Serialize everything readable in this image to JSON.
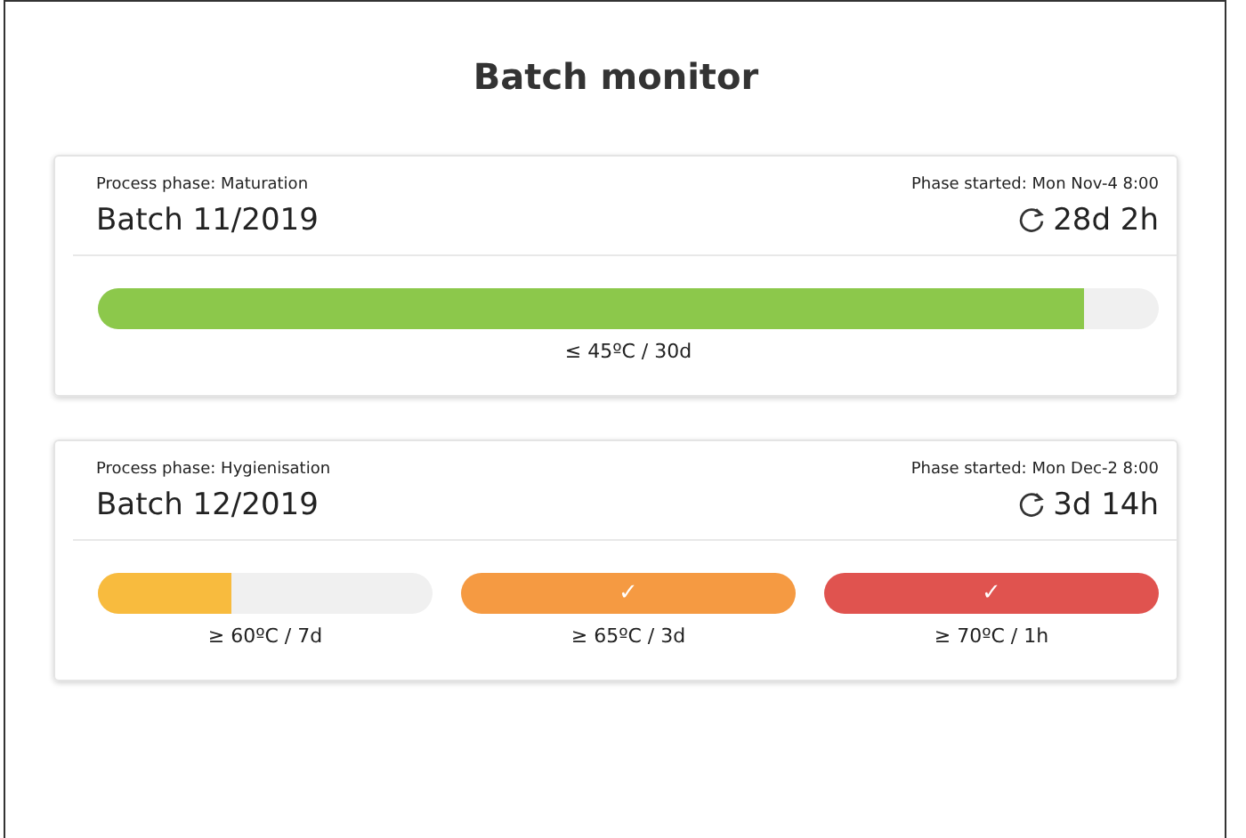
{
  "title": "Batch monitor",
  "batches": [
    {
      "phase": "Process phase: Maturation",
      "started": "Phase started: Mon Nov-4 8:00",
      "name": "Batch 11/2019",
      "elapsed": "28d 2h",
      "bars": [
        {
          "level": 0.93,
          "color": "#8cc84b",
          "label": "≤ 45ºC / 30d"
        }
      ]
    },
    {
      "phase": "Process phase: Hygienisation",
      "started": "Phase started: Mon Dec-2 8:00",
      "name": "Batch 12/2019",
      "elapsed": "3d 14h",
      "bars": [
        {
          "level": 0.4,
          "color": "#f8bb3e",
          "label": "≥ 60ºC / 7d"
        },
        {
          "level": 1,
          "color": "#f59a42",
          "label": "≥ 65ºC / 3d",
          "mark": "✓"
        },
        {
          "level": 1,
          "color": "#e0534f",
          "label": "≥ 70ºC / 1h",
          "mark": "✓"
        }
      ]
    }
  ]
}
